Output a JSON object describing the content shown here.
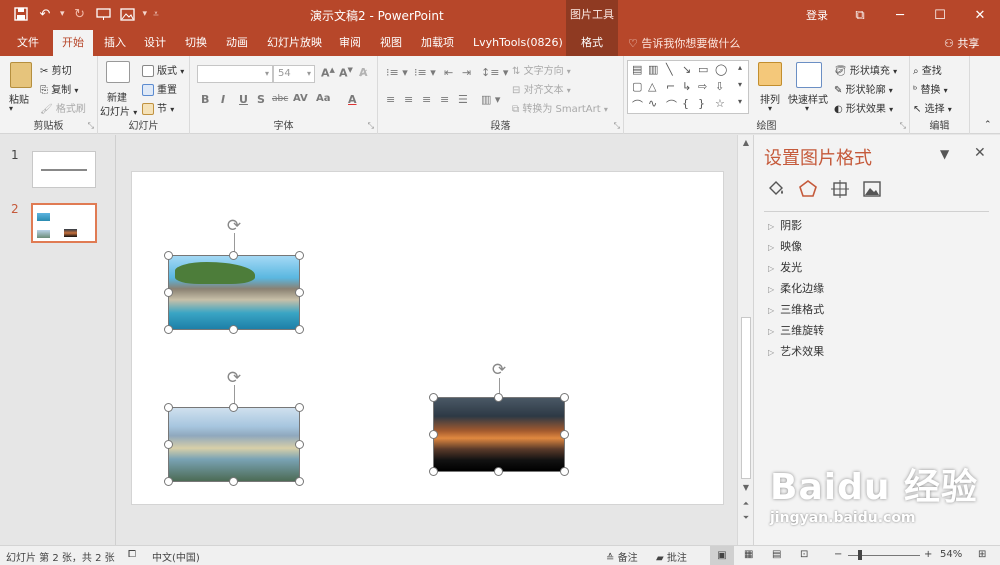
{
  "window": {
    "title": "演示文稿2 - PowerPoint",
    "tool_context": "图片工具",
    "login": "登录",
    "controls": [
      "⧉",
      "─",
      "☐",
      "✕"
    ]
  },
  "qat": {
    "save_icon": "save-icon",
    "undo_icon": "undo-icon",
    "redo_icon": "redo-icon"
  },
  "ribbon_tabs": [
    "文件",
    "开始",
    "插入",
    "设计",
    "切换",
    "动画",
    "幻灯片放映",
    "审阅",
    "视图",
    "加载项",
    "LvyhTools(0826)",
    "格式"
  ],
  "active_tab": "开始",
  "tell_me": "告诉我你想要做什么",
  "share": "共享",
  "clipboard": {
    "paste": "粘贴",
    "cut": "剪切",
    "copy": "复制",
    "format_painter": "格式刷",
    "label": "剪贴板"
  },
  "slides_group": {
    "new_slide_1": "新建",
    "new_slide_2": "幻灯片",
    "layout": "版式",
    "reset": "重置",
    "section": "节",
    "label": "幻灯片"
  },
  "font_group": {
    "font_size": "54",
    "label": "字体",
    "bold": "B",
    "italic": "I",
    "underline": "U",
    "shadow": "S",
    "strike": "abc",
    "spacing": "AV",
    "case": "Aa",
    "color": "A"
  },
  "paragraph_group": {
    "text_direction": "文字方向",
    "align_text": "对齐文本",
    "smartart": "转换为 SmartArt",
    "label": "段落"
  },
  "drawing_group": {
    "arrange": "排列",
    "quick_styles": "快速样式",
    "shape_fill": "形状填充",
    "shape_outline": "形状轮廓",
    "shape_effects": "形状效果",
    "label": "绘图"
  },
  "editing_group": {
    "find": "查找",
    "replace": "替换",
    "select": "选择",
    "label": "编辑"
  },
  "thumbnails": {
    "slide1_num": "1",
    "slide2_num": "2"
  },
  "format_pane": {
    "title": "设置图片格式",
    "items": [
      "阴影",
      "映像",
      "发光",
      "柔化边缘",
      "三维格式",
      "三维旋转",
      "艺术效果"
    ]
  },
  "status": {
    "slide_info": "幻灯片 第 2 张，共 2 张",
    "language": "中文(中国)",
    "notes": "备注",
    "comments": "批注",
    "zoom": "54%"
  },
  "watermark": {
    "main": "Baidu 经验",
    "sub": "jingyan.baidu.com"
  },
  "colors": {
    "accent": "#b7472a",
    "pane_title": "#c55a3b"
  }
}
